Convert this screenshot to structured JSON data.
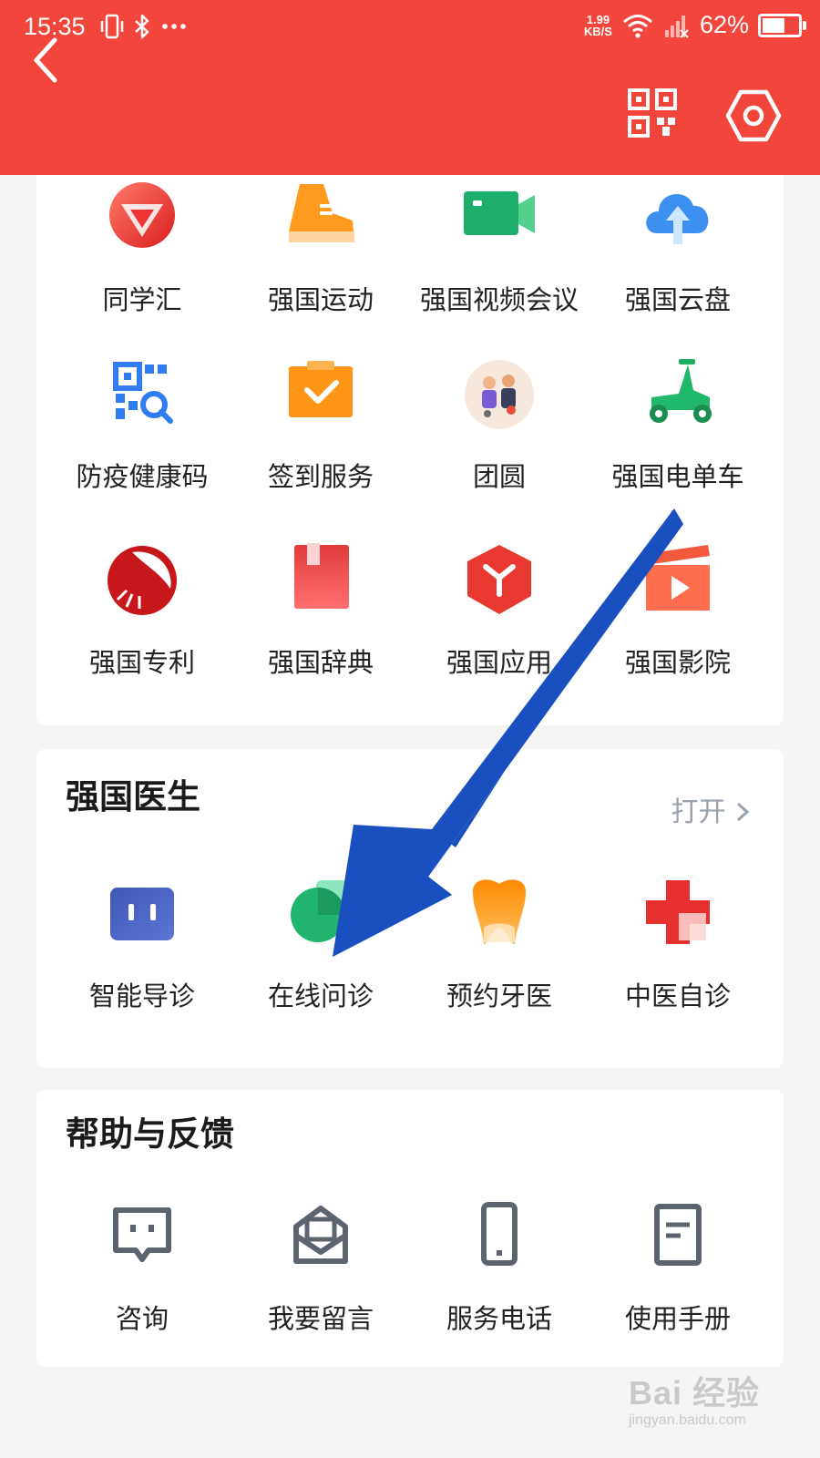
{
  "status_bar": {
    "time": "15:35",
    "speed_value": "1.99",
    "speed_unit": "KB/S",
    "battery": "62%",
    "battery_level": 0.62,
    "icons": [
      "vibrate-icon",
      "bluetooth-icon",
      "more-dots-icon",
      "wifi-icon",
      "signal-icon"
    ]
  },
  "header": {
    "background": "#f2463d",
    "icons": [
      "back-arrow-icon",
      "qr-code-icon",
      "settings-hexagon-icon"
    ]
  },
  "apps_section": {
    "items": [
      {
        "label": "同学汇",
        "icon": "tongxuehui-icon"
      },
      {
        "label": "强国运动",
        "icon": "sneaker-icon"
      },
      {
        "label": "强国视频会议",
        "icon": "video-camera-icon"
      },
      {
        "label": "强国云盘",
        "icon": "cloud-upload-icon"
      },
      {
        "label": "防疫健康码",
        "icon": "health-qr-code-icon"
      },
      {
        "label": "签到服务",
        "icon": "check-in-clipboard-icon"
      },
      {
        "label": "团圆",
        "icon": "family-reunion-icon"
      },
      {
        "label": "强国电单车",
        "icon": "scooter-icon"
      },
      {
        "label": "强国专利",
        "icon": "patent-seal-icon"
      },
      {
        "label": "强国辞典",
        "icon": "dictionary-book-icon"
      },
      {
        "label": "强国应用",
        "icon": "app-cube-icon"
      },
      {
        "label": "强国影院",
        "icon": "cinema-clapper-icon"
      }
    ]
  },
  "doctor_section": {
    "title": "强国医生",
    "open_label": "打开",
    "open_icon": "chevron-right-icon",
    "items": [
      {
        "label": "智能导诊",
        "icon": "smart-guide-icon"
      },
      {
        "label": "在线问诊",
        "icon": "online-consult-chat-icon"
      },
      {
        "label": "预约牙医",
        "icon": "tooth-icon"
      },
      {
        "label": "中医自诊",
        "icon": "medical-cross-icon"
      }
    ]
  },
  "help_section": {
    "title": "帮助与反馈",
    "items": [
      {
        "label": "咨询",
        "icon": "chat-bubble-icon"
      },
      {
        "label": "我要留言",
        "icon": "envelope-icon"
      },
      {
        "label": "服务电话",
        "icon": "phone-icon"
      },
      {
        "label": "使用手册",
        "icon": "manual-document-icon"
      }
    ]
  },
  "annotation": {
    "arrow_color": "#1a4fbf",
    "arrow_icon": "blue-pointer-arrow-icon"
  },
  "watermark": {
    "main": "Bai 经验",
    "sub": "jingyan.baidu.com"
  }
}
